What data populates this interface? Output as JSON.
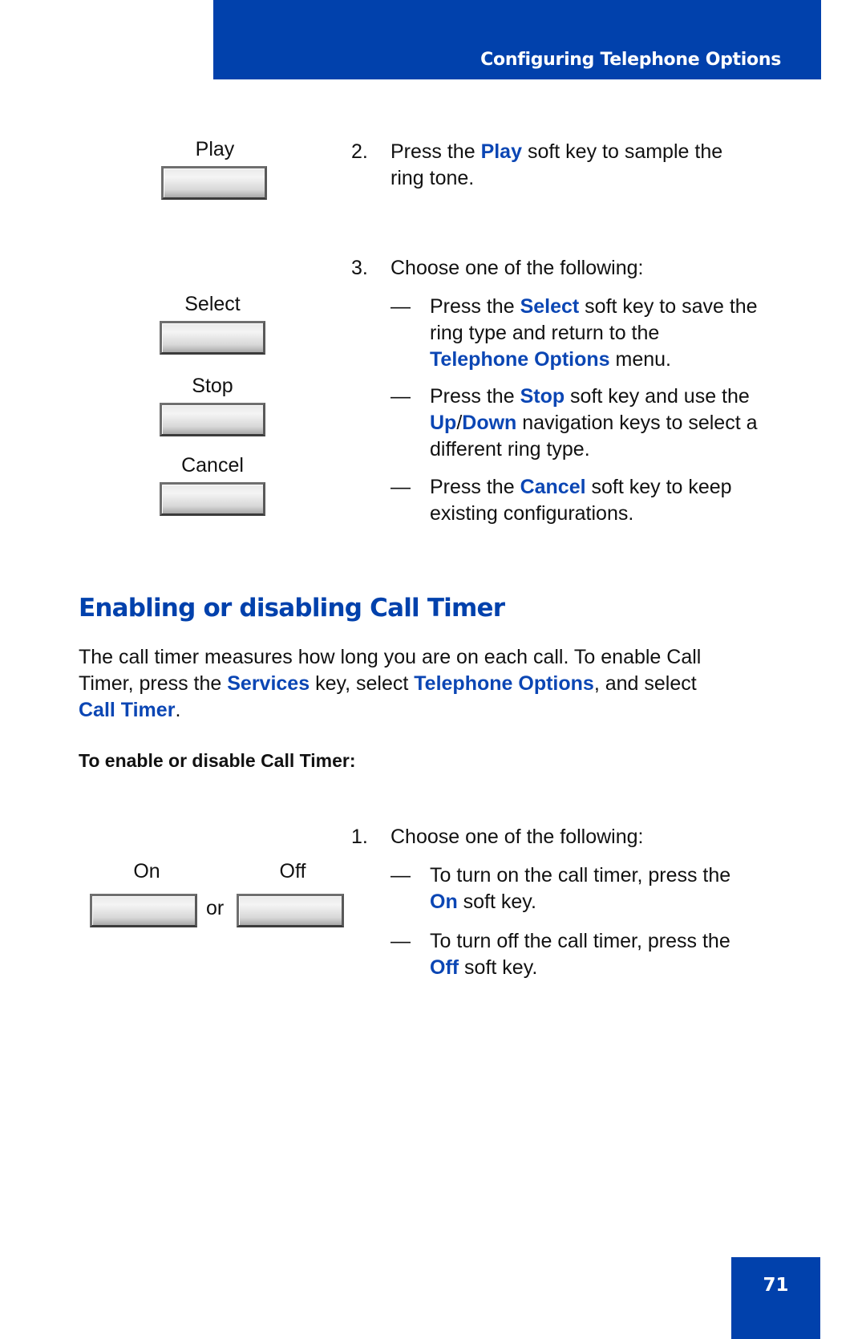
{
  "header": {
    "title": "Configuring Telephone Options"
  },
  "colors": {
    "brand_blue": "#0141ac",
    "keyword_blue": "#0b46b4"
  },
  "softkeys_top": [
    {
      "label": "Play"
    },
    {
      "label": "Select"
    },
    {
      "label": "Stop"
    },
    {
      "label": "Cancel"
    }
  ],
  "step2": {
    "number": "2.",
    "pre": "Press the ",
    "key": "Play",
    "post_line1": " soft key to sample the",
    "line2": "ring tone."
  },
  "step3": {
    "number": "3.",
    "text": "Choose one of the following:",
    "options": [
      {
        "dash": "—",
        "l1_pre": "Press the ",
        "l1_key": "Select",
        "l1_post": " soft key to save the",
        "l2": "ring type and return to the",
        "l3_key": "Telephone Options",
        "l3_post": " menu."
      },
      {
        "dash": "—",
        "l1_pre": "Press the ",
        "l1_key": "Stop",
        "l1_post": " soft key and use the",
        "l2_key_a": "Up",
        "l2_sep": "/",
        "l2_key_b": "Down",
        "l2_post": " navigation keys to select a",
        "l3": "different ring type."
      },
      {
        "dash": "—",
        "l1_pre": "Press the ",
        "l1_key": "Cancel",
        "l1_post": " soft key to keep",
        "l2": "existing configurations."
      }
    ]
  },
  "section": {
    "heading": "Enabling or disabling Call Timer",
    "para_l1": "The call timer measures how long you are on each call. To enable Call",
    "para_l2_a": "Timer, press the ",
    "para_l2_key1": "Services",
    "para_l2_b": " key, select ",
    "para_l2_key2": "Telephone Options",
    "para_l2_c": ", and select",
    "para_l3_key": "Call Timer",
    "para_l3_post": ".",
    "procedure_title": "To enable or disable Call Timer:"
  },
  "softkeys_bottom": {
    "on_label": "On",
    "off_label": "Off",
    "or_text": "or"
  },
  "step1": {
    "number": "1.",
    "text": "Choose one of the following:",
    "options": [
      {
        "dash": "—",
        "l1": "To turn on the call timer, press the",
        "l2_key": "On",
        "l2_post": " soft key."
      },
      {
        "dash": "—",
        "l1": "To turn off the call timer, press the",
        "l2_key": "Off",
        "l2_post": " soft key."
      }
    ]
  },
  "footer": {
    "page_number": "71"
  }
}
